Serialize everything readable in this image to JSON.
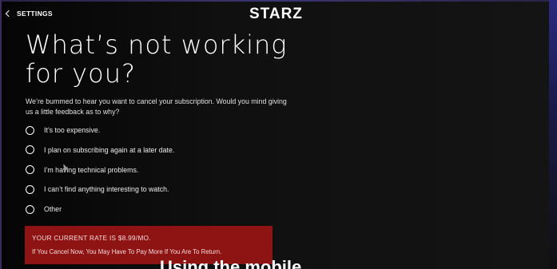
{
  "header": {
    "back_label": "SETTINGS",
    "logo": "STARZ"
  },
  "main": {
    "title_line1": "What’s not working",
    "title_line2": "for you?",
    "subtitle_line1": "We’re bummed to hear you want to cancel your subscription. Would you mind giving",
    "subtitle_line2": "us a little feedback as to why?",
    "options": [
      {
        "label": "It’s too expensive."
      },
      {
        "label": "I plan on subscribing again at a later date."
      },
      {
        "label": "I’m having technical problems."
      },
      {
        "label": "I can’t find anything interesting to watch."
      },
      {
        "label": "Other"
      }
    ]
  },
  "rate_notice": {
    "line1": "YOUR CURRENT RATE IS $8.99/MO.",
    "line2": "If You Cancel Now, You May Have To Pay More If You Are To Return."
  },
  "overlay": {
    "caption": "Using the mobile"
  },
  "colors": {
    "rate_box": "#8e1413",
    "background": "#0b0b0b",
    "accent_text": "#ffffff"
  },
  "icons": {
    "back": "chevron-left-icon",
    "option": "radio-circle-icon",
    "pointer": "mouse-cursor-icon"
  }
}
